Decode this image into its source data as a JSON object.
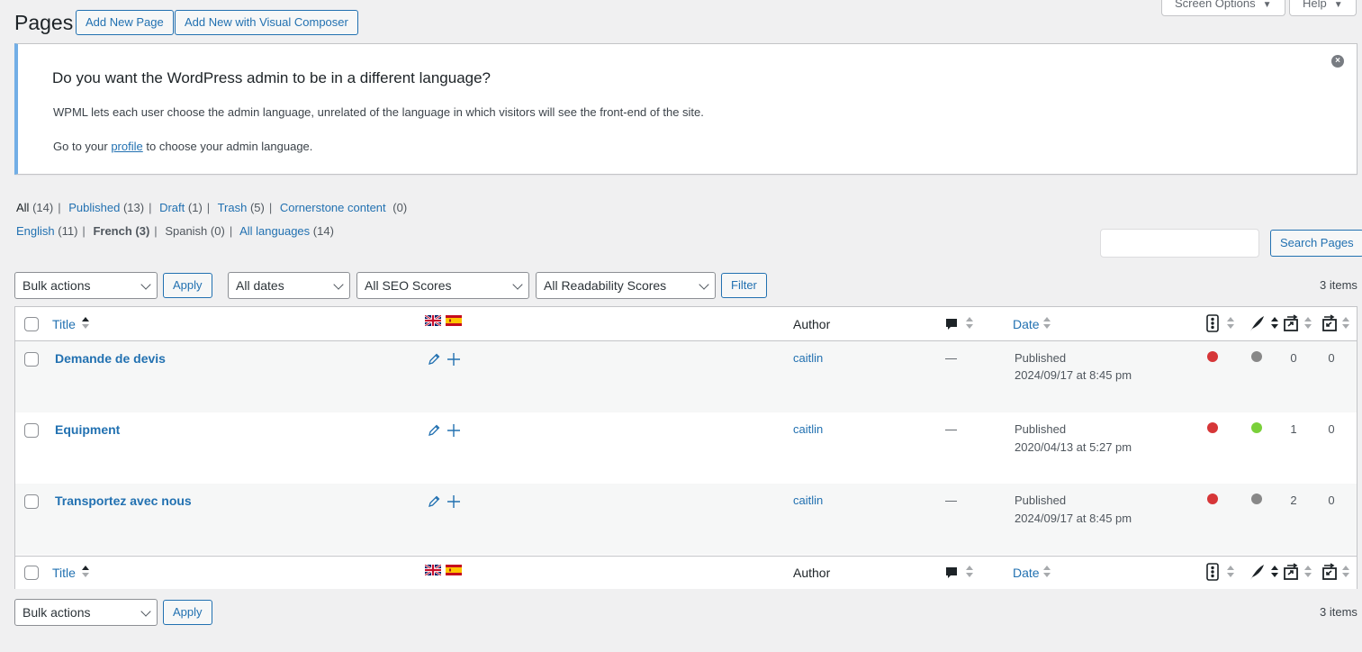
{
  "header": {
    "title": "Pages",
    "add_new": "Add New Page",
    "add_visual": "Add New with Visual Composer",
    "screen_options": "Screen Options",
    "help": "Help"
  },
  "notice": {
    "heading": "Do you want the WordPress admin to be in a different language?",
    "line1": "WPML lets each user choose the admin language, unrelated of the language in which visitors will see the front-end of the site.",
    "line2_prefix": "Go to your",
    "line2_link": "profile",
    "line2_suffix": "to choose your admin language."
  },
  "status_filters": [
    {
      "label": "All",
      "count": "(14)",
      "current": true
    },
    {
      "label": "Published",
      "count": "(13)"
    },
    {
      "label": "Draft",
      "count": "(1)"
    },
    {
      "label": "Trash",
      "count": "(5)"
    },
    {
      "label": "Cornerstone content",
      "count": "(0)"
    }
  ],
  "language_filters": [
    {
      "label": "English",
      "count": "(11)"
    },
    {
      "label": "French",
      "count": "(3)",
      "current": true
    },
    {
      "label": "Spanish",
      "count": "(0)"
    },
    {
      "label": "All languages",
      "count": "(14)"
    }
  ],
  "search": {
    "button": "Search Pages"
  },
  "toolbar": {
    "bulk_actions": "Bulk actions",
    "apply": "Apply",
    "all_dates": "All dates",
    "seo_scores": "All SEO Scores",
    "readability_scores": "All Readability Scores",
    "filter": "Filter",
    "items": "3 items"
  },
  "columns": {
    "title": "Title",
    "author": "Author",
    "date": "Date"
  },
  "rows": [
    {
      "title": "Demande de devis",
      "author": "caitlin",
      "comments": "—",
      "status": "Published",
      "date": "2024/09/17 at 8:45 pm",
      "seo": "#d63638",
      "readability": "#888888",
      "links_in": "0",
      "links_out": "0"
    },
    {
      "title": "Equipment",
      "author": "caitlin",
      "comments": "—",
      "status": "Published",
      "date": "2020/04/13 at 5:27 pm",
      "seo": "#d63638",
      "readability": "#7ad03a",
      "links_in": "1",
      "links_out": "0"
    },
    {
      "title": "Transportez avec nous",
      "author": "caitlin",
      "comments": "—",
      "status": "Published",
      "date": "2024/09/17 at 8:45 pm",
      "seo": "#d63638",
      "readability": "#888888",
      "links_in": "2",
      "links_out": "0"
    }
  ],
  "colors": {
    "accent": "#2271b1",
    "notice_border": "#72aee6",
    "background": "#f0f0f1"
  }
}
